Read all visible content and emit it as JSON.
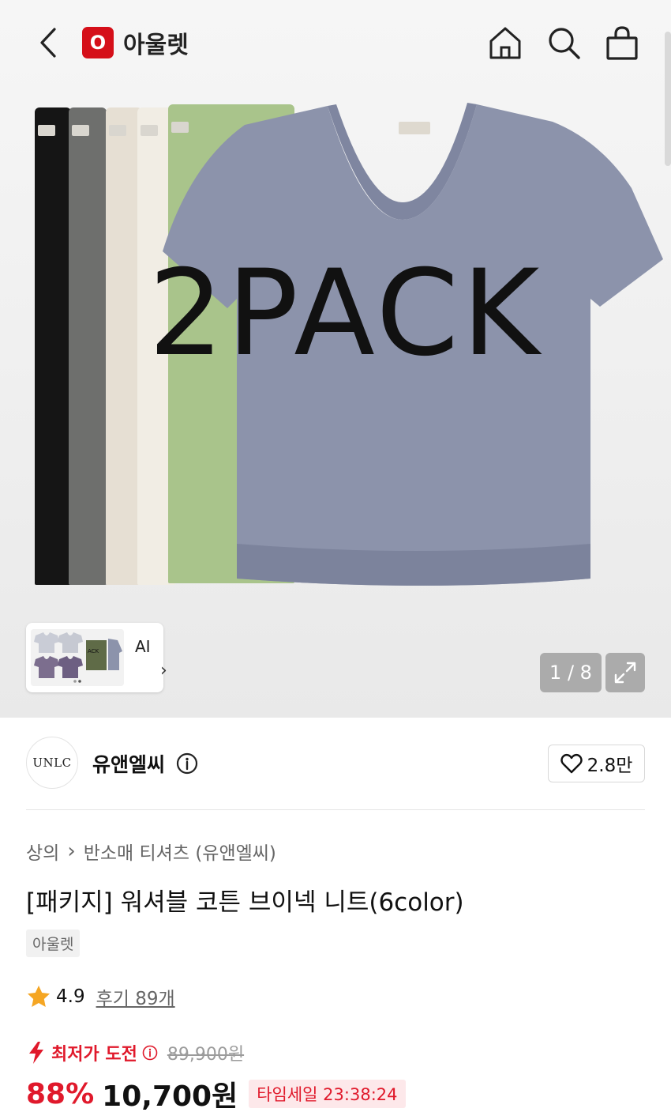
{
  "header": {
    "logo_letter": "O",
    "logo_text": "아울렛",
    "icons": [
      "back-icon",
      "home-icon",
      "search-icon",
      "bag-icon"
    ]
  },
  "gallery": {
    "overlay_text": "2PACK",
    "ai_label": "AI",
    "ai_chevron": "›",
    "counter": "1 / 8"
  },
  "brand": {
    "logo_text": "UNLC",
    "name": "유앤엘씨",
    "likes": "2.8만"
  },
  "breadcrumb": {
    "category": "상의",
    "separator": "›",
    "subcategory": "반소매 티셔츠 (유앤엘씨)"
  },
  "product": {
    "title": "[패키지] 워셔블 코튼 브이넥 니트(6color)",
    "tag": "아울렛",
    "rating": "4.9",
    "reviews": "후기 89개"
  },
  "price": {
    "hint_label": "최저가 도전",
    "original_price": "89,900원",
    "discount": "88%",
    "sale_price": "10,700원",
    "timesale": "타임세일 23:38:24"
  },
  "colors": {
    "accent": "#e0192b",
    "logo_red": "#d50f19",
    "star": "#f5a623"
  }
}
